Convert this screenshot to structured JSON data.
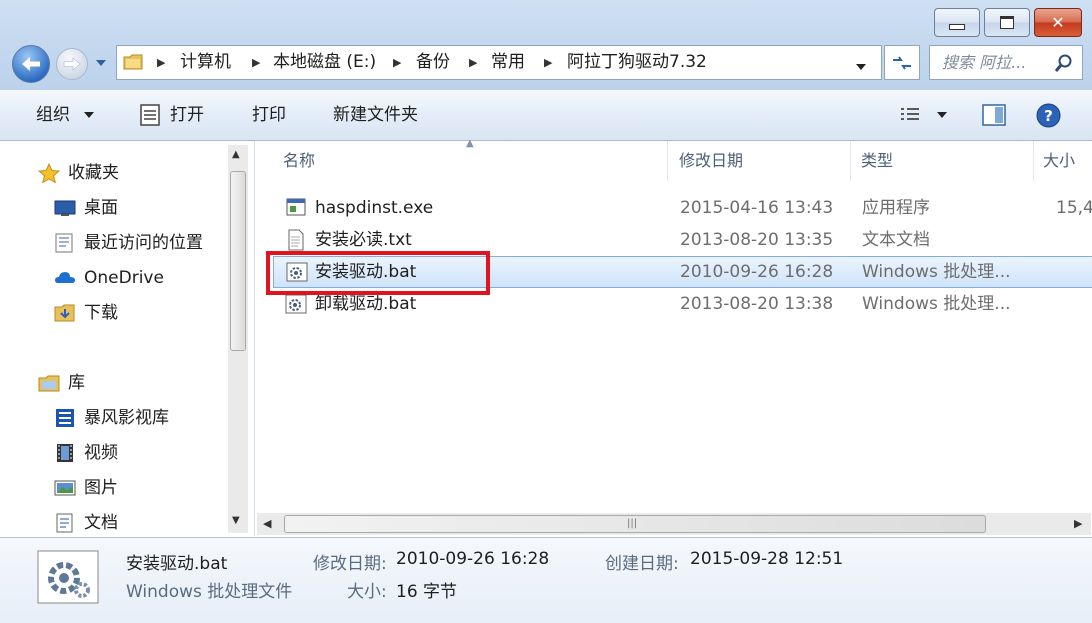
{
  "breadcrumb": [
    "计算机",
    "本地磁盘 (E:)",
    "备份",
    "常用",
    "阿拉丁狗驱动7.32"
  ],
  "search": {
    "placeholder": "搜索 阿拉..."
  },
  "toolbar": {
    "organize": "组织",
    "open": "打开",
    "print": "打印",
    "new_folder": "新建文件夹"
  },
  "nav": {
    "favorites": "收藏夹",
    "desktop": "桌面",
    "recent": "最近访问的位置",
    "onedrive": "OneDrive",
    "downloads": "下载",
    "libraries": "库",
    "storm": "暴风影视库",
    "videos": "视频",
    "pictures": "图片",
    "documents": "文档"
  },
  "columns": {
    "name": "名称",
    "modified": "修改日期",
    "type": "类型",
    "size": "大小"
  },
  "files": [
    {
      "name": "haspdinst.exe",
      "modified": "2015-04-16 13:43",
      "type": "应用程序",
      "size": "15,4",
      "icon": "exe-icon"
    },
    {
      "name": "安装必读.txt",
      "modified": "2013-08-20 13:35",
      "type": "文本文档",
      "size": "",
      "icon": "text-file-icon"
    },
    {
      "name": "安装驱动.bat",
      "modified": "2010-09-26 16:28",
      "type": "Windows 批处理...",
      "size": "",
      "icon": "batch-file-icon",
      "selected": true
    },
    {
      "name": "卸载驱动.bat",
      "modified": "2013-08-20 13:38",
      "type": "Windows 批处理...",
      "size": "",
      "icon": "batch-file-icon"
    }
  ],
  "details": {
    "name": "安装驱动.bat",
    "type": "Windows 批处理文件",
    "modified_label": "修改日期:",
    "modified": "2010-09-26 16:28",
    "created_label": "创建日期:",
    "created": "2015-09-28 12:51",
    "size_label": "大小:",
    "size": "16 字节"
  },
  "highlight_color": "#e0141e"
}
